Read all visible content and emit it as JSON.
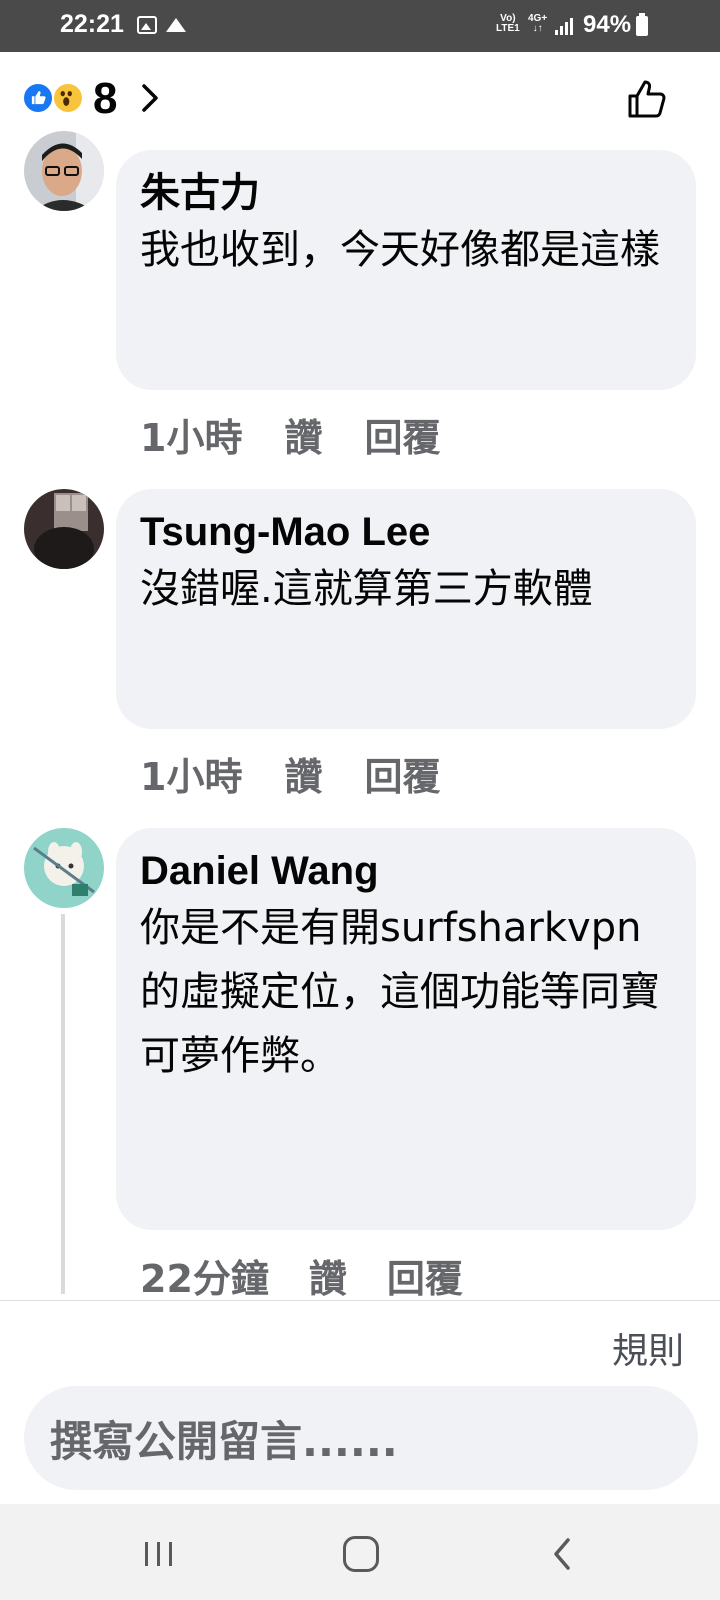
{
  "status_bar": {
    "time": "22:21",
    "volte_line1": "Vo)",
    "volte_line2": "LTE1",
    "network": "4G+",
    "battery": "94%",
    "icons": [
      "gallery-icon",
      "mountain-icon",
      "signal-icon",
      "battery-icon"
    ]
  },
  "header": {
    "reaction_icons": [
      "like-reaction-icon",
      "wow-reaction-icon"
    ],
    "reaction_count": "8",
    "colors": {
      "like": "#1877f2",
      "wow": "#f7c43b"
    }
  },
  "comments": [
    {
      "author": "朱古力",
      "text": "我也收到，今天好像都是這樣",
      "time": "1小時",
      "like_label": "讚",
      "reply_label": "回覆"
    },
    {
      "author": "Tsung-Mao Lee",
      "text": "沒錯喔.這就算第三方軟體",
      "time": "1小時",
      "like_label": "讚",
      "reply_label": "回覆"
    },
    {
      "author": "Daniel Wang",
      "text": "你是不是有開surfsharkvpn的虛擬定位，這個功能等同寶可夢作弊。",
      "time": "22分鐘",
      "like_label": "讚",
      "reply_label": "回覆"
    }
  ],
  "footer": {
    "rules_label": "規則",
    "composer_placeholder": "撰寫公開留言......"
  },
  "nav": {
    "icons": [
      "recent-apps-icon",
      "home-icon",
      "back-icon"
    ]
  },
  "colors": {
    "status_bar_bg": "#4a4a4a",
    "bubble_bg": "#f0f2f5",
    "meta_text": "#65676b"
  }
}
